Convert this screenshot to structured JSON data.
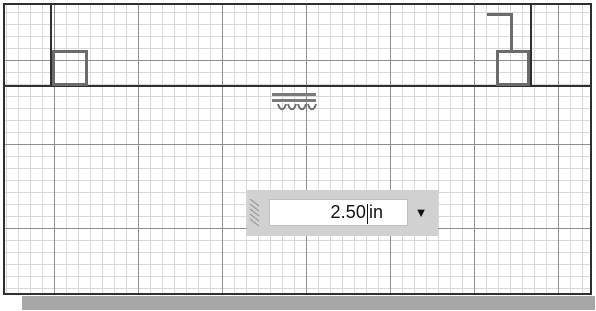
{
  "dimension": {
    "value": "2.50",
    "unit": "in",
    "dropdown_icon": "caret-down-icon"
  },
  "icons": {
    "ceiling_light": "ceiling-light-icon",
    "resize_grip": "grip-icon"
  }
}
